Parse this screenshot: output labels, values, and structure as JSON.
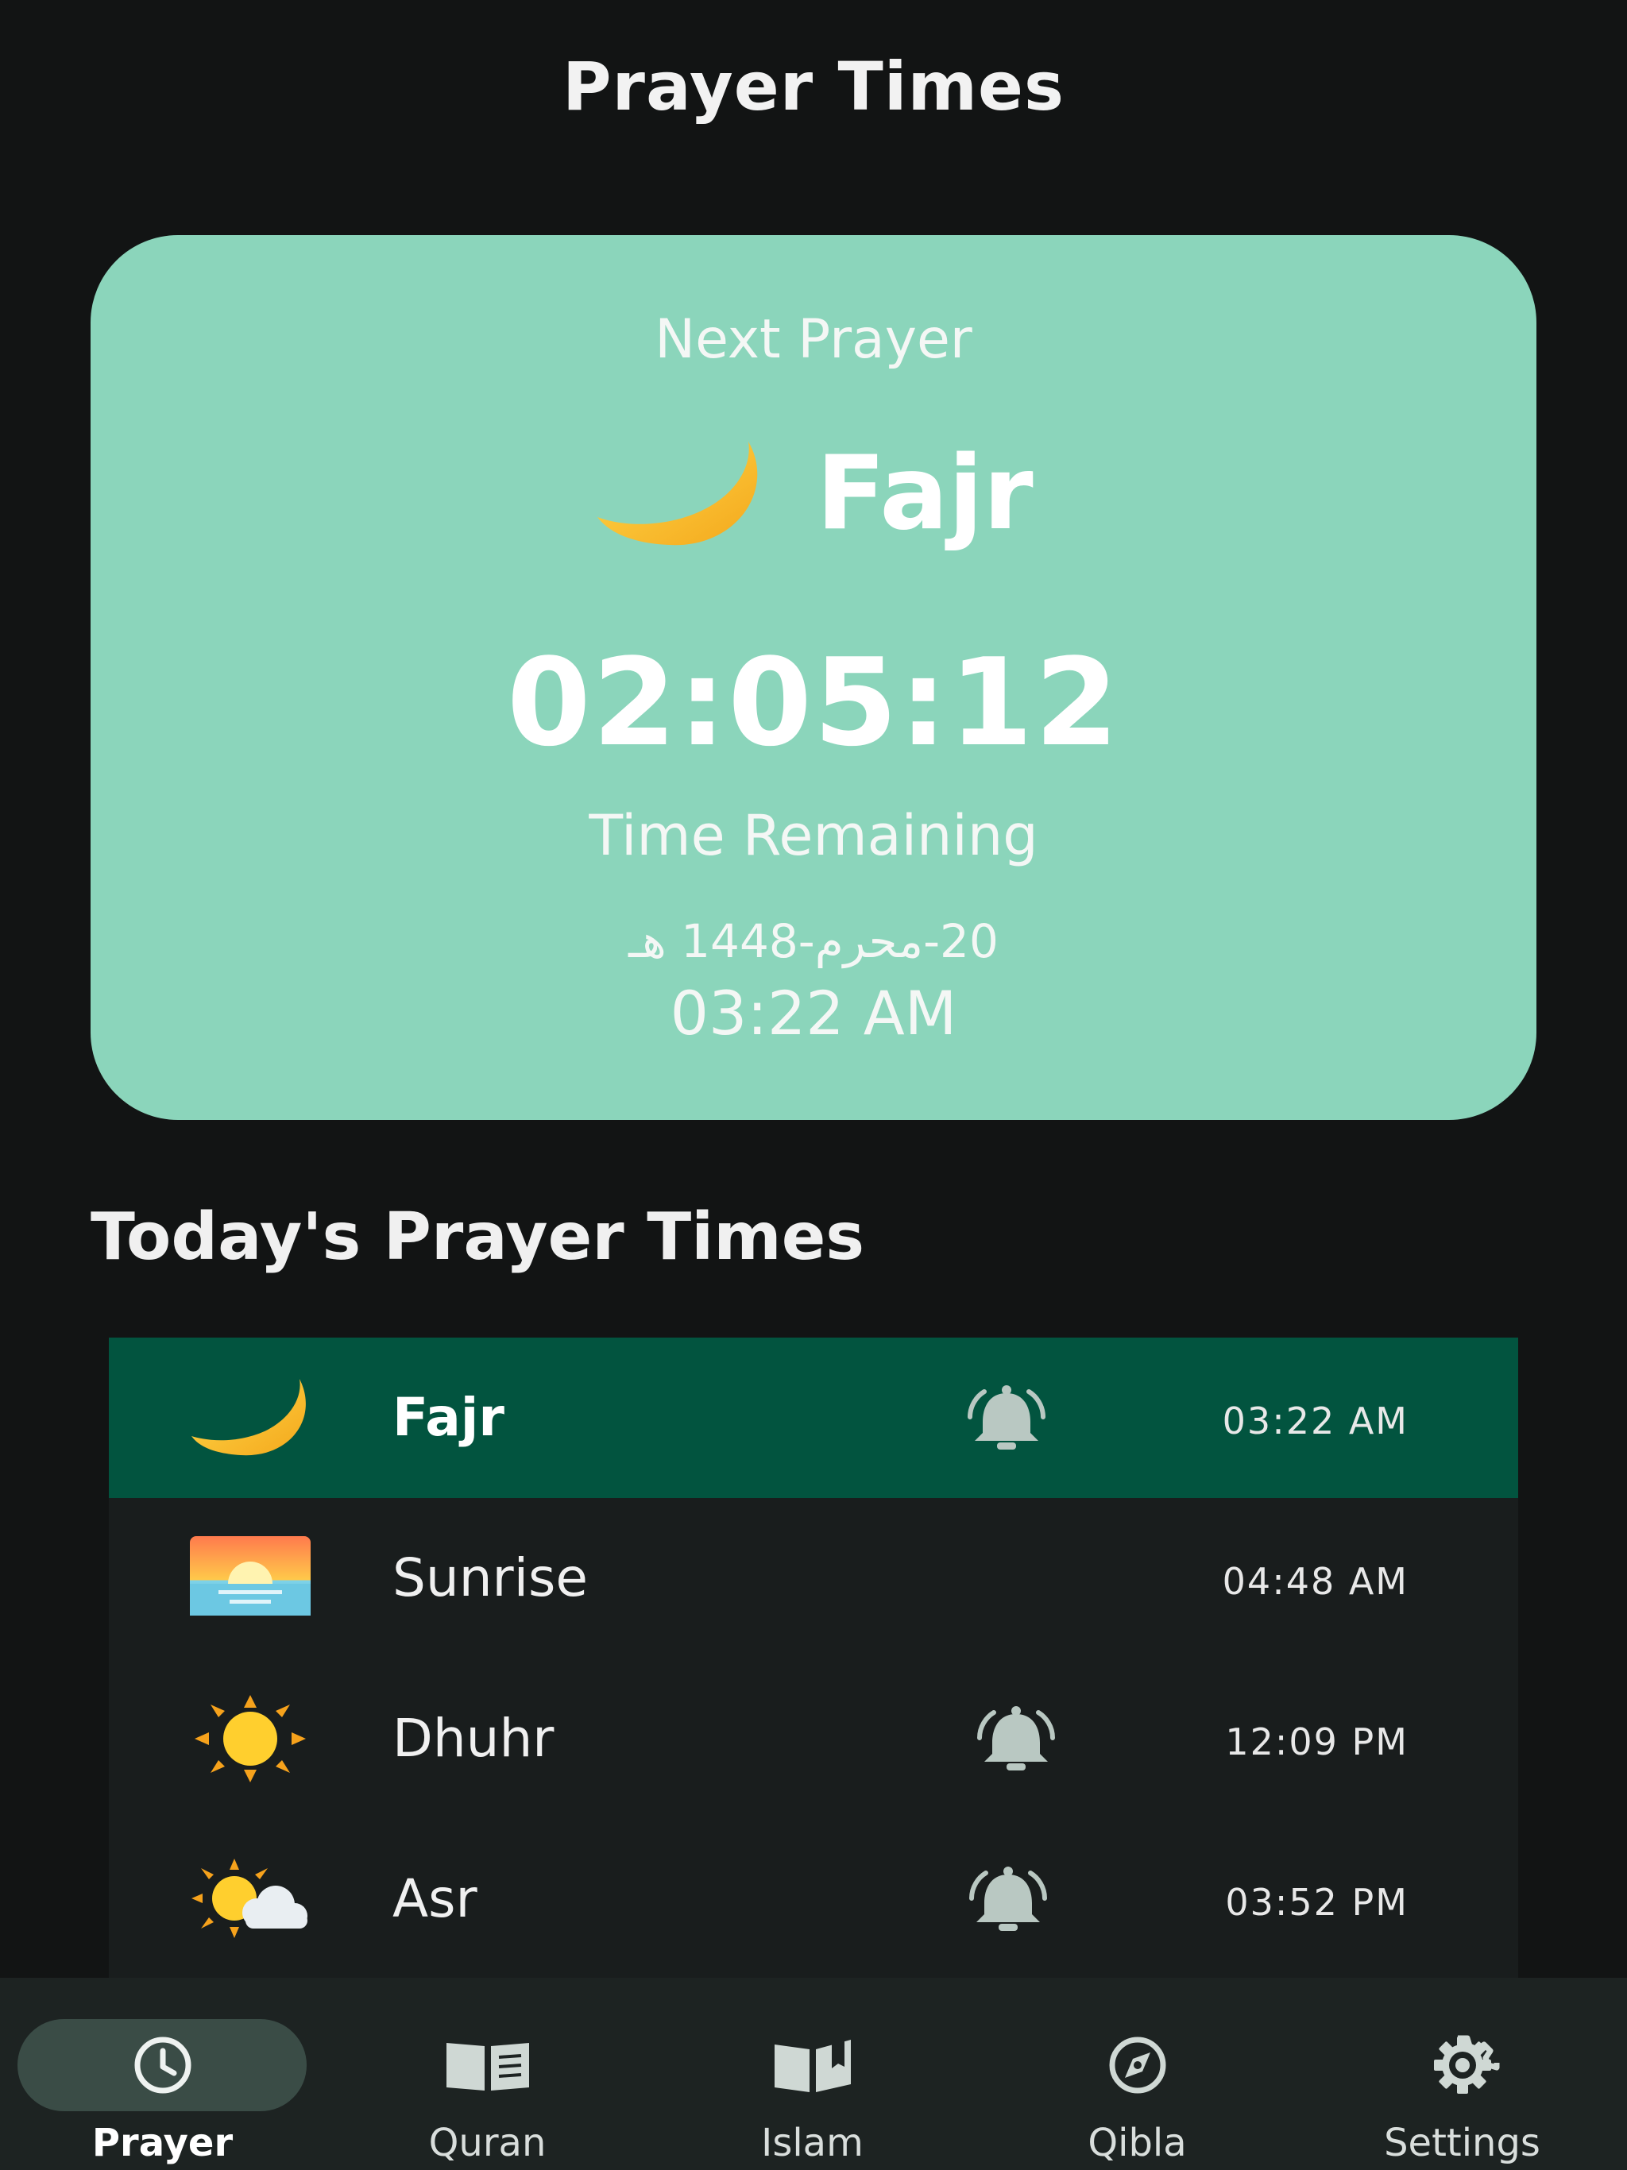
{
  "header": {
    "title": "Prayer Times"
  },
  "next_prayer": {
    "label": "Next Prayer",
    "name": "Fajr",
    "icon": "crescent-moon-icon",
    "countdown": "02:05:12",
    "remaining_label": "Time Remaining",
    "hijri_date": "20-محرم-1448 هـ",
    "time": "03:22 AM"
  },
  "today": {
    "title": "Today's Prayer Times",
    "prayers": [
      {
        "name": "Fajr",
        "time": "03:22 AM",
        "icon": "crescent-moon-icon",
        "alarm": true,
        "active": true
      },
      {
        "name": "Sunrise",
        "time": "04:48 AM",
        "icon": "sunrise-icon",
        "alarm": false,
        "active": false
      },
      {
        "name": "Dhuhr",
        "time": "12:09 PM",
        "icon": "sun-icon",
        "alarm": true,
        "active": false
      },
      {
        "name": "Asr",
        "time": "03:52 PM",
        "icon": "sun-behind-cloud-icon",
        "alarm": true,
        "active": false
      }
    ]
  },
  "nav": {
    "items": [
      {
        "label": "Prayer",
        "icon": "clock-icon",
        "active": true
      },
      {
        "label": "Quran",
        "icon": "book-icon",
        "active": false
      },
      {
        "label": "Islam",
        "icon": "open-book-icon",
        "active": false
      },
      {
        "label": "Qibla",
        "icon": "compass-icon",
        "active": false
      },
      {
        "label": "Settings",
        "icon": "gear-icon",
        "active": false
      }
    ]
  },
  "colors": {
    "background": "#121414",
    "card": "#8bd5bb",
    "active_row": "#02543f",
    "list_bg": "#191d1d",
    "nav_bg": "#1d2322",
    "nav_pill": "#3a4c46"
  }
}
